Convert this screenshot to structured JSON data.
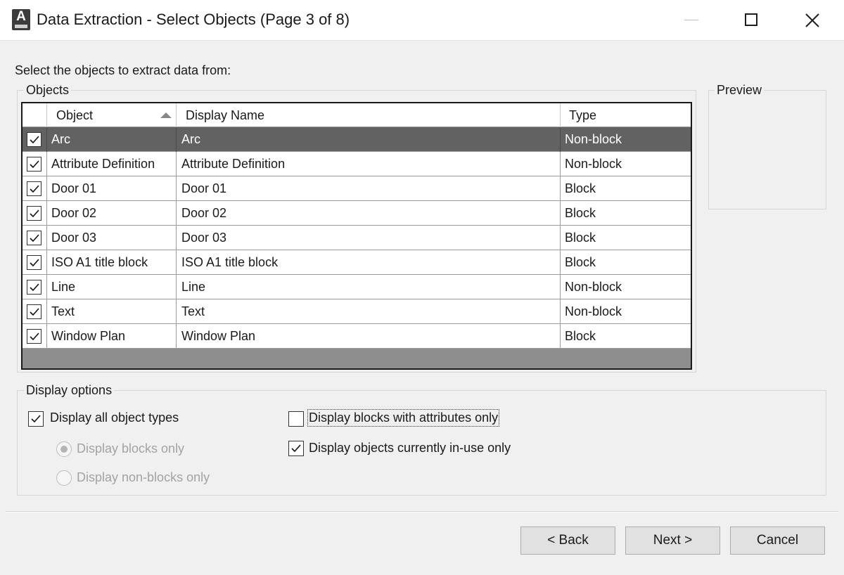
{
  "window": {
    "title": "Data Extraction - Select Objects (Page 3 of 8)",
    "icon_letter": "A"
  },
  "instruction": "Select the objects to extract data from:",
  "objects_group": {
    "label": "Objects",
    "columns": [
      "Object",
      "Display Name",
      "Type"
    ],
    "sort": {
      "column": "Object",
      "direction": "ascending"
    },
    "rows": [
      {
        "checked": true,
        "object": "Arc",
        "display_name": "Arc",
        "type": "Non-block",
        "selected": true
      },
      {
        "checked": true,
        "object": "Attribute Definition",
        "display_name": "Attribute Definition",
        "type": "Non-block",
        "selected": false
      },
      {
        "checked": true,
        "object": "Door 01",
        "display_name": "Door 01",
        "type": "Block",
        "selected": false
      },
      {
        "checked": true,
        "object": "Door 02",
        "display_name": "Door 02",
        "type": "Block",
        "selected": false
      },
      {
        "checked": true,
        "object": "Door 03",
        "display_name": "Door 03",
        "type": "Block",
        "selected": false
      },
      {
        "checked": true,
        "object": "ISO A1 title block",
        "display_name": "ISO A1 title block",
        "type": "Block",
        "selected": false
      },
      {
        "checked": true,
        "object": "Line",
        "display_name": "Line",
        "type": "Non-block",
        "selected": false
      },
      {
        "checked": true,
        "object": "Text",
        "display_name": "Text",
        "type": "Non-block",
        "selected": false
      },
      {
        "checked": true,
        "object": "Window Plan",
        "display_name": "Window Plan",
        "type": "Block",
        "selected": false
      }
    ]
  },
  "preview_group": {
    "label": "Preview"
  },
  "display_options": {
    "label": "Display options",
    "all_object_types": {
      "label": "Display all object types",
      "checked": true
    },
    "blocks_only": {
      "label": "Display blocks only",
      "selected": true,
      "enabled": false
    },
    "non_blocks_only": {
      "label": "Display non-blocks only",
      "selected": false,
      "enabled": false
    },
    "blocks_with_attributes_only": {
      "label": "Display blocks with attributes only",
      "checked": false
    },
    "objects_in_use_only": {
      "label": "Display objects currently in-use only",
      "checked": true
    }
  },
  "buttons": {
    "back": "< Back",
    "next": "Next >",
    "cancel": "Cancel"
  },
  "colors": {
    "selected_row": "#626262",
    "window_bg": "#f0f0f0",
    "disabled_text": "#a3a3a3"
  }
}
